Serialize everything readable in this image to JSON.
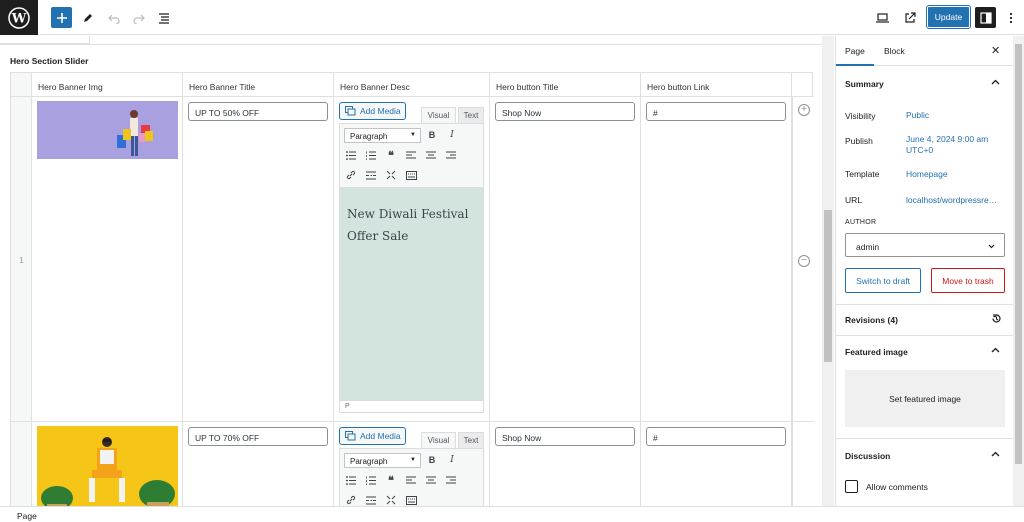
{
  "toolbar": {
    "update_label": "Update"
  },
  "section": {
    "title": "Hero Section Slider"
  },
  "table": {
    "columns": [
      "Hero Banner Img",
      "Hero Banner Title",
      "Hero Banner Desc",
      "Hero button Title",
      "Hero button Link"
    ],
    "rows": [
      {
        "num": "1",
        "title": "UP TO 50% OFF",
        "add_media": "Add Media",
        "tab_visual": "Visual",
        "tab_text": "Text",
        "format": "Paragraph",
        "desc": "New Diwali Festival Offer Sale",
        "status": "P",
        "button_title": "Shop Now",
        "button_link": "#"
      },
      {
        "num": "",
        "title": "UP TO 70% OFF",
        "add_media": "Add Media",
        "tab_visual": "Visual",
        "tab_text": "Text",
        "format": "Paragraph",
        "button_title": "Shop Now",
        "button_link": "#"
      }
    ]
  },
  "sidebar": {
    "tabs": [
      "Page",
      "Block"
    ],
    "summary_title": "Summary",
    "visibility_label": "Visibility",
    "visibility_value": "Public",
    "publish_label": "Publish",
    "publish_value_line1": "June 4, 2024 9:00 am",
    "publish_value_line2": "UTC+0",
    "template_label": "Template",
    "template_value": "Homepage",
    "url_label": "URL",
    "url_value": "localhost/wordpressre…",
    "author_label": "AUTHOR",
    "author_value": "admin",
    "switch_draft": "Switch to draft",
    "move_trash": "Move to trash",
    "revisions": "Revisions (4)",
    "featured_title": "Featured image",
    "set_featured": "Set featured image",
    "discussion_title": "Discussion",
    "allow_comments": "Allow comments"
  },
  "footer": {
    "breadcrumb": "Page"
  },
  "colors": {
    "accent": "#2271b1",
    "danger": "#cc1818",
    "editor_bg": "#d3e3dd"
  }
}
